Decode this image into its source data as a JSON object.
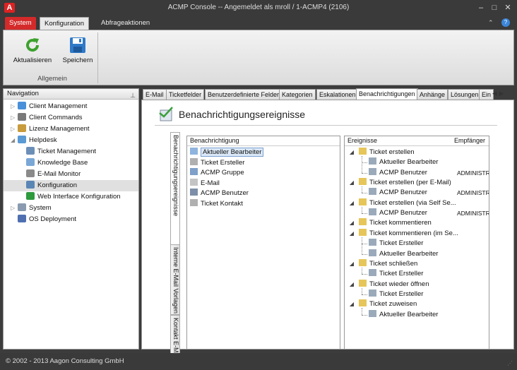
{
  "window": {
    "title": "ACMP Console -- Angemeldet als mroll / 1-ACMP4 (2106)",
    "logo": "A",
    "minimize": "–",
    "maximize": "□",
    "close": "✕"
  },
  "ribbon": {
    "tabs": [
      "System",
      "Konfiguration",
      "Abfrageaktionen"
    ],
    "help": "?",
    "buttons": {
      "refresh": "Aktualisieren",
      "save": "Speichern"
    },
    "group": "Allgemein"
  },
  "nav": {
    "header": "Navigation",
    "items": [
      {
        "label": "Client Management",
        "icon": "client-management-icon",
        "expander": "▷"
      },
      {
        "label": "Client Commands",
        "icon": "client-commands-icon",
        "expander": "▷"
      },
      {
        "label": "Lizenz Management",
        "icon": "license-icon",
        "expander": "▷"
      },
      {
        "label": "Helpdesk",
        "icon": "helpdesk-icon",
        "expander": "◢"
      },
      {
        "label": "Ticket Management",
        "icon": "ticket-icon",
        "expander": ""
      },
      {
        "label": "Knowledge Base",
        "icon": "knowledge-base-icon",
        "expander": ""
      },
      {
        "label": "E-Mail Monitor",
        "icon": "email-monitor-icon",
        "expander": ""
      },
      {
        "label": "Konfiguration",
        "icon": "configuration-icon",
        "expander": ""
      },
      {
        "label": "Web Interface Konfiguration",
        "icon": "globe-icon",
        "expander": ""
      },
      {
        "label": "System",
        "icon": "system-icon",
        "expander": "▷"
      },
      {
        "label": "OS Deployment",
        "icon": "os-deployment-icon",
        "expander": ""
      }
    ]
  },
  "content_tabs": [
    "E-Mail",
    "Ticketfelder",
    "Benutzerdefinierte Felder",
    "Kategorien",
    "Eskalationen",
    "Benachrichtigungen",
    "Anhänge",
    "Lösungen",
    "Ein"
  ],
  "section": {
    "title": "Benachrichtigungsereignisse"
  },
  "vertical_tabs": [
    "Benachrichtigungsereignisse",
    "Interne E-Mail Vorlagen",
    "Kontakt E-Mail V"
  ],
  "notifications": {
    "header": "Benachrichtigung",
    "items": [
      "Aktueller Bearbeiter",
      "Ticket Ersteller",
      "ACMP Gruppe",
      "E-Mail",
      "ACMP Benutzer",
      "Ticket Kontakt"
    ]
  },
  "events": {
    "header_events": "Ereignisse",
    "header_recipients": "Empfänger",
    "rows": [
      {
        "label": "Ticket erstellen",
        "level": 0,
        "recipient": ""
      },
      {
        "label": "Aktueller Bearbeiter",
        "level": 1,
        "recipient": ""
      },
      {
        "label": "ACMP Benutzer",
        "level": 1,
        "recipient": "ADMINISTRA"
      },
      {
        "label": "Ticket erstellen (per E-Mail)",
        "level": 0,
        "recipient": ""
      },
      {
        "label": "ACMP Benutzer",
        "level": 1,
        "recipient": "ADMINISTRA"
      },
      {
        "label": "Ticket erstellen (via Self Se...",
        "level": 0,
        "recipient": ""
      },
      {
        "label": "ACMP Benutzer",
        "level": 1,
        "recipient": "ADMINISTRA"
      },
      {
        "label": "Ticket kommentieren",
        "level": 0,
        "recipient": ""
      },
      {
        "label": "Ticket kommentieren (im Se...",
        "level": 0,
        "recipient": ""
      },
      {
        "label": "Ticket Ersteller",
        "level": 1,
        "recipient": ""
      },
      {
        "label": "Aktueller Bearbeiter",
        "level": 1,
        "recipient": ""
      },
      {
        "label": "Ticket schließen",
        "level": 0,
        "recipient": ""
      },
      {
        "label": "Ticket Ersteller",
        "level": 1,
        "recipient": ""
      },
      {
        "label": "Ticket wieder öffnen",
        "level": 0,
        "recipient": ""
      },
      {
        "label": "Ticket Ersteller",
        "level": 1,
        "recipient": ""
      },
      {
        "label": "Ticket zuweisen",
        "level": 0,
        "recipient": ""
      },
      {
        "label": "Aktueller Bearbeiter",
        "level": 1,
        "recipient": ""
      }
    ]
  },
  "status": {
    "text": "© 2002 - 2013 Aagon Consulting GmbH"
  }
}
